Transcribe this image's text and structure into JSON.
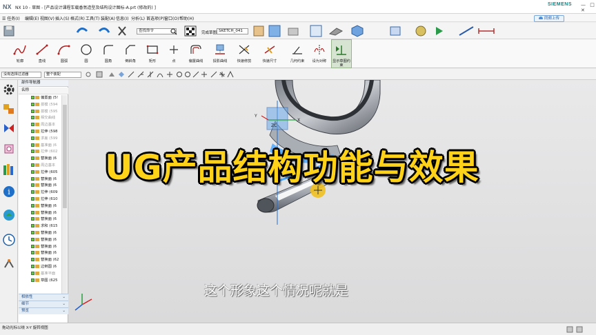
{
  "window": {
    "app_logo": "NX",
    "title": "NX 10 - 草图 - [产品设计课程车载香氛造型及结构设计图标-A.prt (修改的) ]",
    "brand": "SIEMENS",
    "controls": [
      "—",
      "□",
      "✕"
    ]
  },
  "menu": {
    "items": [
      "☰ 任务(I)",
      "编辑(E)",
      "视图(V)",
      "插入(S)",
      "格式(R)",
      "工具(T)",
      "装配(A)",
      "信息(I)",
      "分析(L)",
      "首选项(P)",
      "窗口(O)",
      "帮助(H)"
    ],
    "share_button": "同频上传"
  },
  "toolbar": {
    "search_placeholder": "查找命令",
    "finish_sketch_label": "完成草图",
    "sketch_name": "SKETCH_041"
  },
  "ribbon": {
    "items": [
      "轮廓",
      "直线",
      "圆弧",
      "圆",
      "圆角",
      "倒斜角",
      "矩形",
      "点",
      "偏置曲线",
      "投影曲线",
      "快速修剪",
      "快速尺寸",
      "几何约束",
      "设为对称",
      "显示草图约束"
    ]
  },
  "filters": {
    "selection_filter": "没有选择过滤器",
    "scope": "整个装配"
  },
  "navigator": {
    "title": "部件导航器",
    "column_name": "名称",
    "items": [
      {
        "label": "偏置面 (5!",
        "dim": false
      },
      {
        "label": "拔模 (594",
        "dim": true
      },
      {
        "label": "拔模 (595",
        "dim": true
      },
      {
        "label": "相交曲线",
        "dim": true
      },
      {
        "label": "周边基本",
        "dim": true
      },
      {
        "label": "拉伸 (598",
        "dim": false
      },
      {
        "label": "求差 (599",
        "dim": true
      },
      {
        "label": "基准面 (6",
        "dim": true
      },
      {
        "label": "拉伸 (602",
        "dim": true
      },
      {
        "label": "替换面 (6",
        "dim": false
      },
      {
        "label": "周边基本",
        "dim": true
      },
      {
        "label": "拉伸 (605",
        "dim": false
      },
      {
        "label": "替换面 (6",
        "dim": false
      },
      {
        "label": "替换面 (6",
        "dim": false
      },
      {
        "label": "拉伸 (609",
        "dim": false
      },
      {
        "label": "拉伸 (610",
        "dim": false
      },
      {
        "label": "替换面 (6",
        "dim": false
      },
      {
        "label": "替换面 (6",
        "dim": false
      },
      {
        "label": "替换面 (6",
        "dim": false
      },
      {
        "label": "求和 (615",
        "dim": false
      },
      {
        "label": "替换面 (6",
        "dim": false
      },
      {
        "label": "替换面 (6",
        "dim": false
      },
      {
        "label": "替换面 (6",
        "dim": false
      },
      {
        "label": "替换面 (6",
        "dim": false
      },
      {
        "label": "替换面 (62",
        "dim": false
      },
      {
        "label": "边倒圆 (6",
        "dim": false
      },
      {
        "label": "基准平面",
        "dim": true
      },
      {
        "label": "草图 (625",
        "dim": false
      }
    ],
    "sections": [
      "相依性",
      "细节",
      "预览"
    ]
  },
  "viewport": {
    "axis_labels": {
      "x": "X",
      "y": "Y",
      "zc": "ZC"
    },
    "overlay_title": "UG产品结构功能与效果",
    "subtitle": "这个形象这个情况呢就是"
  },
  "status": {
    "text": "拖动光标以绕 X-Y 旋转视图"
  },
  "colors": {
    "title_text": "#ffd21a",
    "title_outline": "#000000",
    "brand": "#0a8a8a",
    "panel_accent": "#1f4f8a"
  }
}
